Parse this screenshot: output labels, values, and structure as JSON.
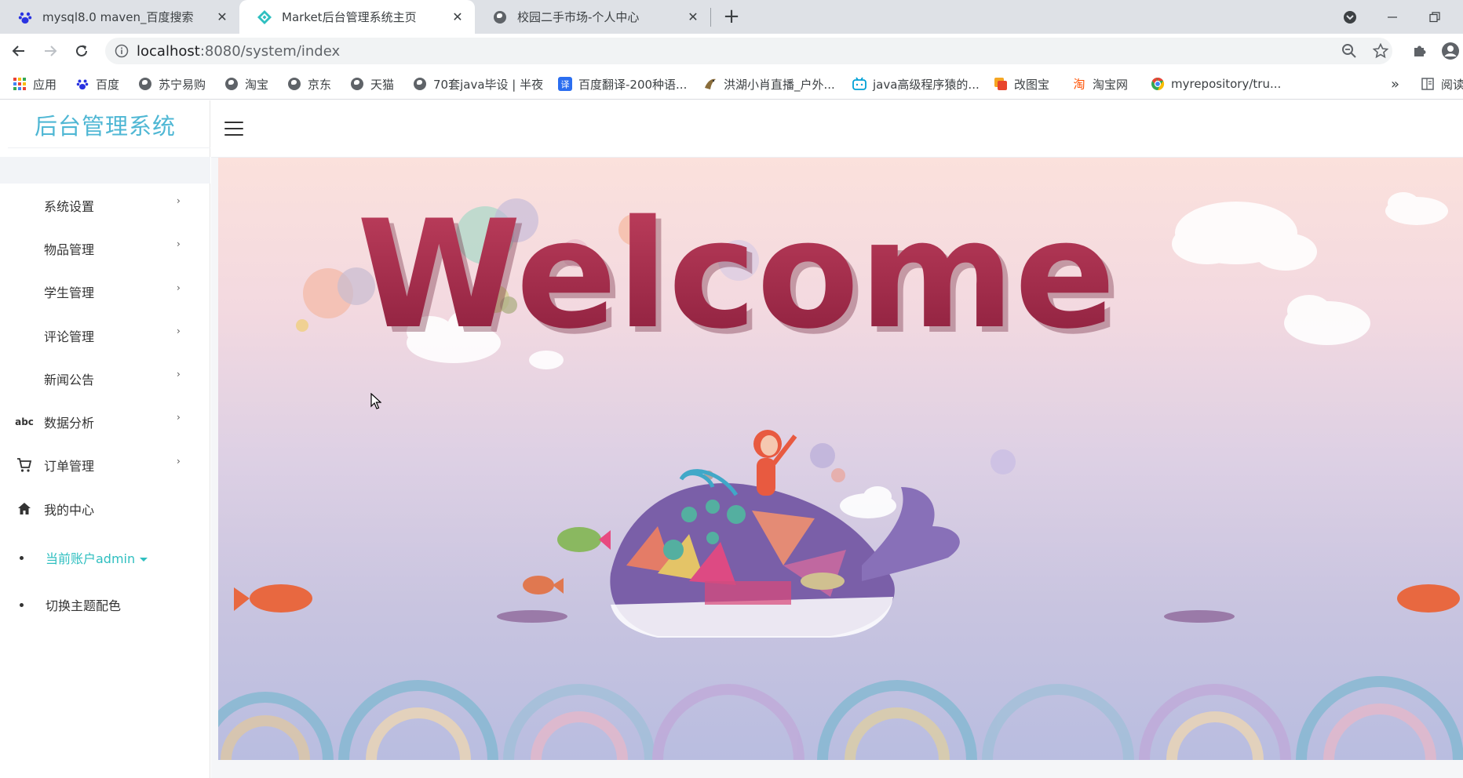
{
  "browser": {
    "tabs": [
      {
        "title": "mysql8.0 maven_百度搜索",
        "active": false
      },
      {
        "title": "Market后台管理系统主页",
        "active": true
      },
      {
        "title": "校园二手市场-个人中心",
        "active": false
      }
    ],
    "url_host": "localhost",
    "url_path": ":8080/system/index",
    "bookmarks": [
      {
        "label": "应用"
      },
      {
        "label": "百度"
      },
      {
        "label": "苏宁易购"
      },
      {
        "label": "淘宝"
      },
      {
        "label": "京东"
      },
      {
        "label": "天猫"
      },
      {
        "label": "70套java毕设 | 半夜"
      },
      {
        "label": "百度翻译-200种语..."
      },
      {
        "label": "洪湖小肖直播_户外..."
      },
      {
        "label": "java高级程序猿的..."
      },
      {
        "label": "改图宝"
      },
      {
        "label": "淘宝网"
      },
      {
        "label": "myrepository/tru..."
      }
    ],
    "bookmarks_more": "»",
    "reading_list": "阅读"
  },
  "app": {
    "brand": "后台管理系统",
    "menu": [
      {
        "label": "系统设置",
        "icon": "",
        "has_arrow": true
      },
      {
        "label": "物品管理",
        "icon": "",
        "has_arrow": true
      },
      {
        "label": "学生管理",
        "icon": "",
        "has_arrow": true
      },
      {
        "label": "评论管理",
        "icon": "",
        "has_arrow": true
      },
      {
        "label": "新闻公告",
        "icon": "",
        "has_arrow": true
      },
      {
        "label": "数据分析",
        "icon": "abc",
        "has_arrow": true
      },
      {
        "label": "订单管理",
        "icon": "cart-icon",
        "has_arrow": true
      },
      {
        "label": "我的中心",
        "icon": "home-icon",
        "has_arrow": false
      }
    ],
    "arrow_glyph": "›",
    "account_label": "当前账户admin",
    "account_color": "#2fbfc0",
    "theme_label": "切换主题配色",
    "brand_color": "#4fb7d4"
  },
  "banner": {
    "welcome_text": "Welcome"
  }
}
